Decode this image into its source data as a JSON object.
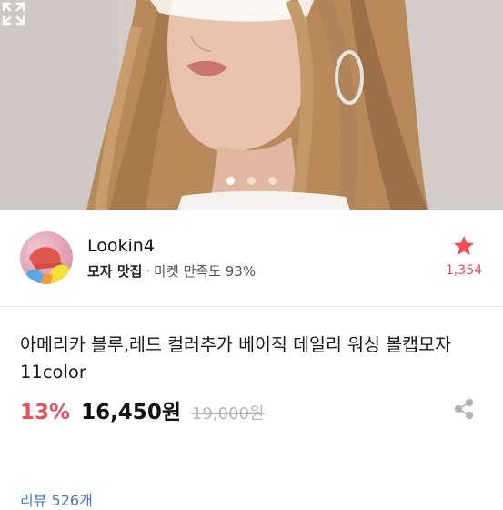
{
  "hero": {
    "image_desc_icon": "product-photo",
    "page_dots": 3,
    "active_dot": 0
  },
  "seller": {
    "name": "Lookin4",
    "category": "모자 맛집",
    "separator": "·",
    "satisfaction": "마켓 만족도 93%",
    "favorite_count": "1,354"
  },
  "product": {
    "title": "아메리카 블루,레드 컬러추가 베이직 데일리 워싱 볼캡모자 11color",
    "discount": "13%",
    "price": "16,450원",
    "original_price": "19,000원"
  },
  "reviews": {
    "label": "리뷰 526개"
  },
  "colors": {
    "accent": "#e8505b",
    "link": "#4a78b8"
  }
}
